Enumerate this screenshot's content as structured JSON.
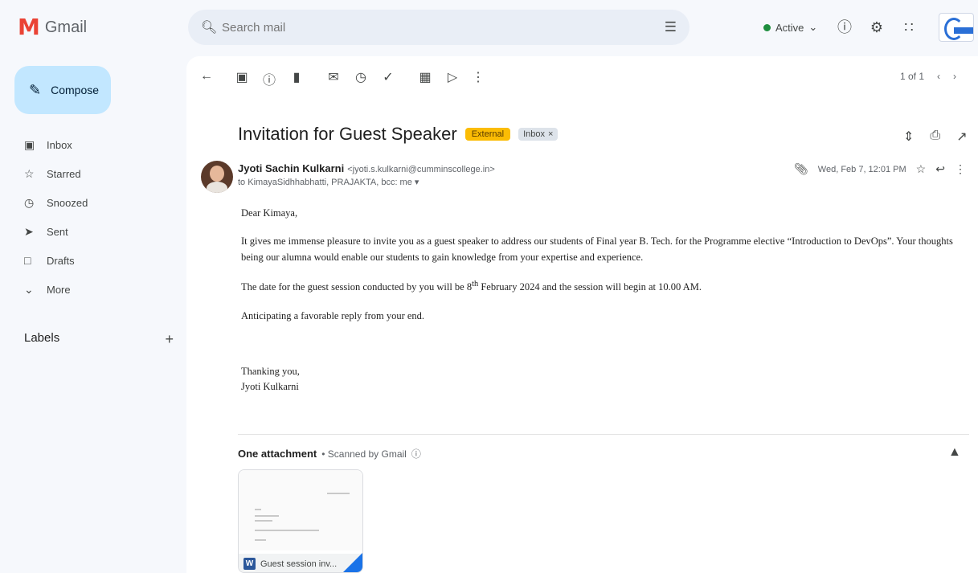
{
  "app": {
    "name": "Gmail"
  },
  "search": {
    "placeholder": "Search mail"
  },
  "status": {
    "label": "Active"
  },
  "sidebar": {
    "compose": "Compose",
    "items": [
      {
        "label": "Inbox",
        "icon": "inbox-icon"
      },
      {
        "label": "Starred",
        "icon": "star-icon"
      },
      {
        "label": "Snoozed",
        "icon": "clock-icon"
      },
      {
        "label": "Sent",
        "icon": "send-icon"
      },
      {
        "label": "Drafts",
        "icon": "draft-icon"
      },
      {
        "label": "More",
        "icon": "chevron-down-icon"
      }
    ],
    "labels_heading": "Labels"
  },
  "toolbar": {
    "pager": "1 of 1"
  },
  "email": {
    "subject": "Invitation for Guest Speaker",
    "badge_external": "External",
    "badge_inbox": "Inbox",
    "sender_name": "Jyoti Sachin Kulkarni",
    "sender_email": "<jyoti.s.kulkarni@cumminscollege.in>",
    "to": "to KimayaSidhhabhatti, PRAJAKTA, bcc: me",
    "date": "Wed, Feb 7, 12:01 PM",
    "greeting": "Dear Kimaya,",
    "para1": "It gives me immense pleasure to invite you as a guest speaker to address our students of Final year B. Tech. for the Programme elective “Introduction to DevOps”. Your thoughts being our alumna would enable our students to gain knowledge from your expertise and experience.",
    "para2_before": "The date for the guest session conducted by you will be 8",
    "para2_sup": "th",
    "para2_after": " February 2024 and the session will begin at 10.00 AM.",
    "para3": "Anticipating a favorable reply from your end.",
    "closing": "Thanking you,",
    "signature": "Jyoti Kulkarni"
  },
  "attachments": {
    "heading": "One attachment",
    "scanned": "• Scanned by Gmail",
    "file_label": "Guest session inv..."
  }
}
